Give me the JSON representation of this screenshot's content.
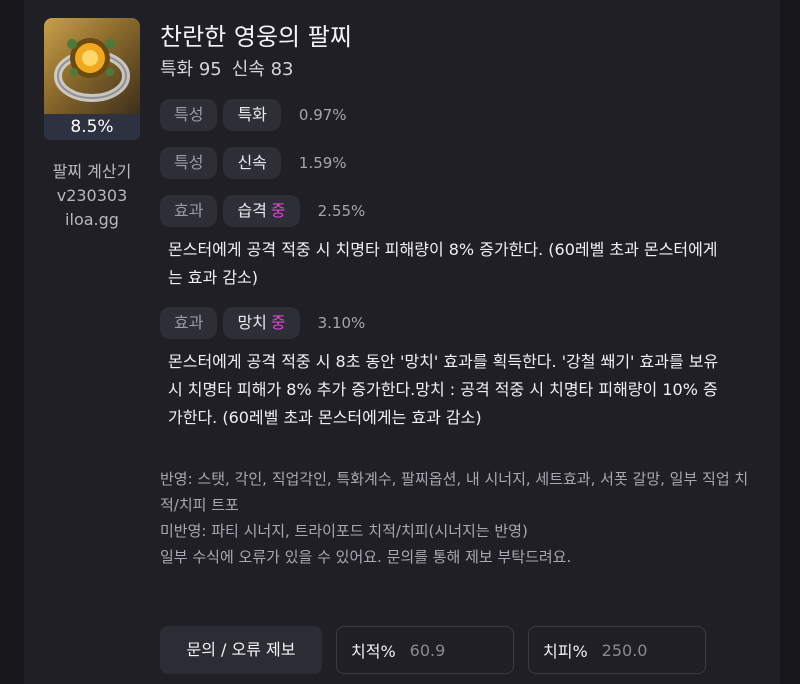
{
  "item": {
    "name": "찬란한 영웅의 팔찌",
    "stats_line": [
      "특화 95",
      "신속 83"
    ],
    "percent": "8.5%"
  },
  "app": {
    "name": "팔찌 계산기",
    "version": "v230303",
    "site": "iloa.gg"
  },
  "effects": [
    {
      "kind": "특성",
      "name": "특화",
      "grade": "",
      "value": "0.97%",
      "desc": ""
    },
    {
      "kind": "특성",
      "name": "신속",
      "grade": "",
      "value": "1.59%",
      "desc": ""
    },
    {
      "kind": "효과",
      "name": "습격",
      "grade": "중",
      "value": "2.55%",
      "desc": "몬스터에게 공격 적중 시 치명타 피해량이 8% 증가한다. (60레벨 초과 몬스터에게는 효과 감소)"
    },
    {
      "kind": "효과",
      "name": "망치",
      "grade": "중",
      "value": "3.10%",
      "desc": "몬스터에게 공격 적중 시 8초 동안 '망치' 효과를 획득한다. '강철 쐐기' 효과를 보유 시 치명타 피해가 8% 추가 증가한다.망치 : 공격 적중 시 치명타 피해량이 10% 증가한다. (60레벨 초과 몬스터에게는 효과 감소)"
    }
  ],
  "notes": {
    "applied": "반영: 스탯, 각인, 직업각인, 특화계수, 팔찌옵션, 내 시너지, 세트효과, 서폿 갈망, 일부 직업 치적/치피 트포",
    "not_applied": "미반영: 파티 시너지, 트라이포드 치적/치피(시너지는 반영)",
    "disclaimer": "일부 수식에 오류가 있을 수 있어요. 문의를 통해 제보 부탁드려요."
  },
  "bottom": {
    "report_button": "문의 / 오류 제보",
    "crit_rate": {
      "label": "치적%",
      "value": "60.9"
    },
    "crit_dmg": {
      "label": "치피%",
      "value": "250.0"
    }
  },
  "colors": {
    "grade_accent": "#e245d6",
    "background": "#1f1f25",
    "chip": "#2e2e36"
  }
}
